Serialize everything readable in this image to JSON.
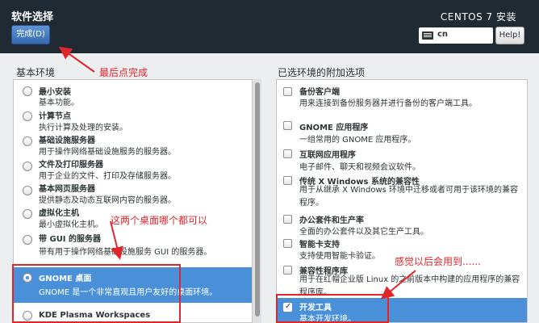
{
  "header": {
    "title": "软件选择",
    "done_label": "完成(D)",
    "product_title": "CENTOS 7 安装",
    "keyboard_layout": "cn",
    "keyboard_icon": "keyboard-icon",
    "help_label": "Help!"
  },
  "left": {
    "label": "基本环境",
    "items": [
      {
        "title": "最小安装",
        "desc": "基本功能。"
      },
      {
        "title": "计算节点",
        "desc": "执行计算及处理的安装。"
      },
      {
        "title": "基础设施服务器",
        "desc": "用于操作网络基础设施服务的服务器。"
      },
      {
        "title": "文件及打印服务器",
        "desc": "用于企业的文件、打印及存储服务器。"
      },
      {
        "title": "基本网页服务器",
        "desc": "提供静态及动态互联网内容的服务器。"
      },
      {
        "title": "虚拟化主机",
        "desc": "最小虚拟化主机。"
      },
      {
        "title": "带 GUI 的服务器",
        "desc": "带有用于操作网络基础设施服务 GUI 的服务器。"
      },
      {
        "title": "GNOME 桌面",
        "desc": "GNOME 是一个非常直观且用户友好的桌面环境。"
      },
      {
        "title": "KDE Plasma Workspaces",
        "desc": ""
      }
    ],
    "selected_index": 7
  },
  "right": {
    "label": "已选环境的附加选项",
    "items": [
      {
        "title": "备份客户端",
        "desc": "用来连接到备份服务器并进行备份的客户端工具。"
      },
      {
        "title": "GNOME 应用程序",
        "desc": "一组常用的 GNOME 应用程序。"
      },
      {
        "title": "互联网应用程序",
        "desc": "电子邮件、聊天和视频会议软件。"
      },
      {
        "title": "传统 X Windows 系统的兼容性",
        "desc": "用于从继承 X Windows 环境中迁移或者可用于该环境的兼容程序。"
      },
      {
        "title": "办公套件和生产率",
        "desc": "全面的办公套件以及其它生产工具。"
      },
      {
        "title": "智能卡支持",
        "desc": "支持使用智能卡验证。"
      },
      {
        "title": "兼容性程序库",
        "desc": "用于在红帽企业版 Linux 的之前版本中构建的应用程序的兼容程序库。"
      },
      {
        "title": "开发工具",
        "desc": "基本开发环境。"
      }
    ],
    "checked_index": 7
  },
  "annotations": {
    "click_done": "最后点完成",
    "either_desktop": "这两个桌面哪个都可以",
    "useful_later": "感觉以后会用到......"
  },
  "colors": {
    "header_bg": "#1f2a33",
    "selection": "#4a90d9",
    "annotation": "#e0252b"
  }
}
